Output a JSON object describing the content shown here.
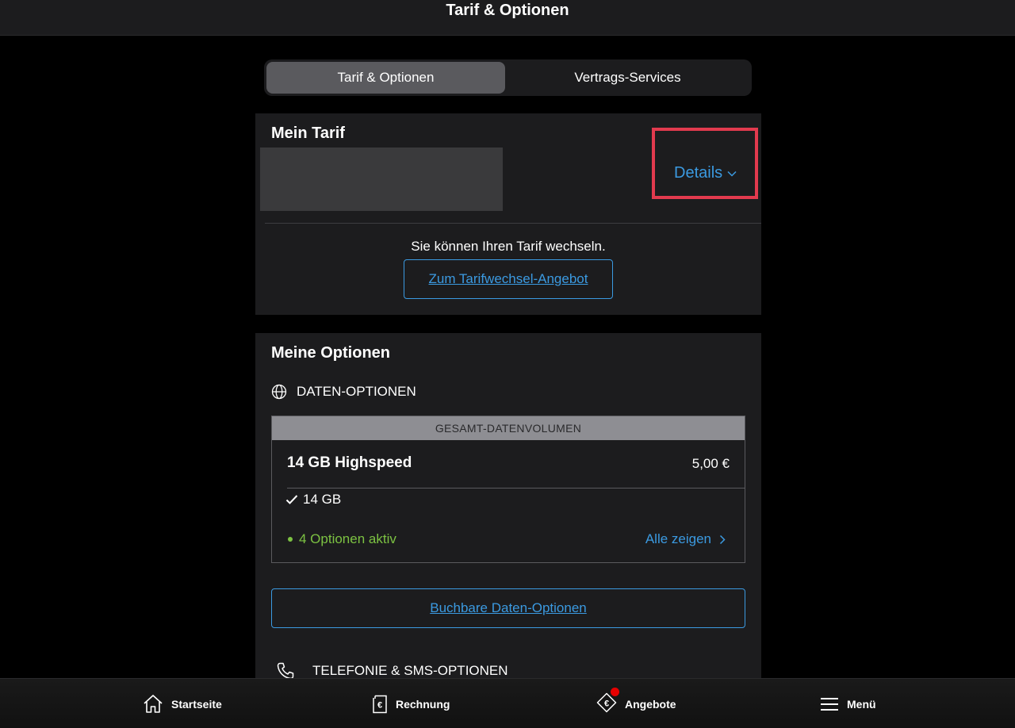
{
  "header": {
    "title": "Tarif & Optionen"
  },
  "segments": {
    "active": "Tarif & Optionen",
    "inactive": "Vertrags-Services"
  },
  "tarif": {
    "heading": "Mein Tarif",
    "details_label": "Details",
    "change_message": "Sie können Ihren Tarif wechseln.",
    "change_button": "Zum Tarifwechsel-Angebot"
  },
  "options": {
    "heading": "Meine Optionen",
    "data_options_label": "DATEN-OPTIONEN",
    "box": {
      "band": "GESAMT-DATENVOLUMEN",
      "name": "14 GB Highspeed",
      "price": "5,00 €",
      "volume": "14 GB",
      "active_count": "4 Optionen aktiv",
      "show_all": "Alle zeigen"
    },
    "bookable_button": "Buchbare Daten-Optionen",
    "telephony_label": "TELEFONIE & SMS-OPTIONEN"
  },
  "nav": {
    "home": "Startseite",
    "bill": "Rechnung",
    "offers": "Angebote",
    "menu": "Menü"
  },
  "colors": {
    "accent": "#3b9ae1",
    "highlight": "#e23a4e",
    "active_green": "#7cc242",
    "badge": "#e60000"
  },
  "icons": [
    "globe-icon",
    "checkmark-icon",
    "chevron-down-icon",
    "chevron-right-icon",
    "phone-icon",
    "home-icon",
    "bill-icon",
    "offers-tag-icon",
    "hamburger-menu-icon"
  ]
}
